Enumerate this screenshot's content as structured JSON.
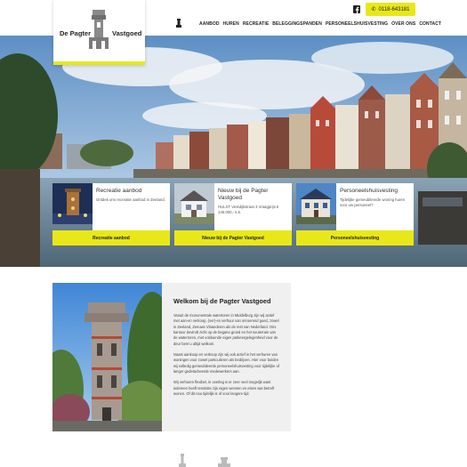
{
  "header": {
    "logo_left": "De Pagter",
    "logo_right": "Vastgoed",
    "phone": "0118-643181",
    "nav": [
      "AANBOD",
      "HUREN",
      "RECREATIE",
      "BELEGGINGSPANDEN",
      "PERSONEELSHUISVESTING",
      "OVER ONS",
      "CONTACT"
    ]
  },
  "cards": [
    {
      "title": "Recreatie aanbod",
      "desc": "Ontdek ons recreatie aanbod in Zeeland.",
      "button": "Recreatie aanbod"
    },
    {
      "title": "Nieuw bij de Pagter Vastgoed",
      "desc": "HULST Vestdijkstraat 3 Vraagprijs € 145.000,- k.k.",
      "button": "Nieuw bij de Pagter Vastgoed"
    },
    {
      "title": "Personeelshuisvesting",
      "desc": "Tijdelijke gemeubileerde woning huren voor uw personeel?",
      "button": "Personeelshuisvesting"
    }
  ],
  "welcome": {
    "title": "Welkom bij de Pagter Vastgoed",
    "paragraphs": [
      "Vanuit de monumentale watertoren in Middelburg zijn wij actief met aan-en verkoop, (ver)-en verhuur van onroerend goed, zowel in Zeeland, Zeeuws Vlaanderen als de rest van Nederland. Ons kantoor bevindt zicht op de begane grond en het souterrain van de watertoren, met voldoende eigen parkeergelegenheid voor de deur bent u altijd welkom.",
      "Naast aankoop en verkoop zijn wij ook actief in het verhuren van woningen voor zowel particulieren als bedrijven. Hier voor beiden wij volledig gemeubileerde personeelshuisvesting voor tijdelijke of langer gedetacheerde medewerkers aan.",
      "Wij verhuren flexibel, in overleg is er zeer veel mogelijk want iedereen heeft tenslotte zijn eigen wensen en eisen wat betreft wonen. Of dit nou tijdelijk is of voor langere tijd."
    ]
  },
  "colors": {
    "accent": "#e8e819"
  },
  "icons": [
    "facebook-icon",
    "phone-icon",
    "tower-icon"
  ]
}
